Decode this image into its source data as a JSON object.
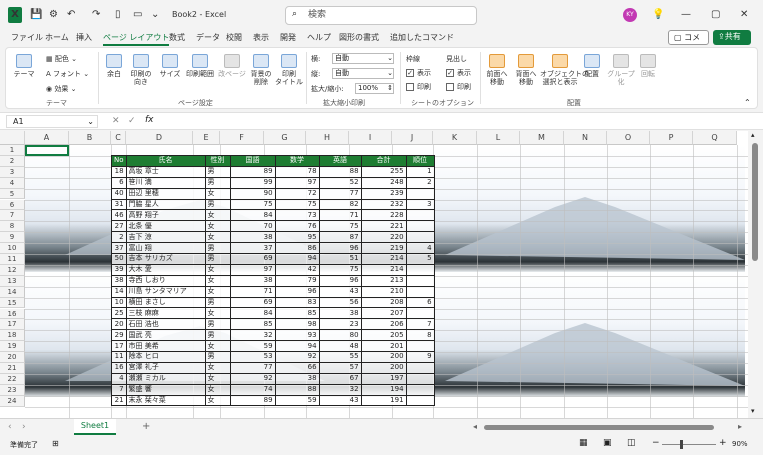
{
  "app": {
    "logo": "X",
    "doc_title": "Book2 - Excel",
    "search_placeholder": "検索",
    "avatar": "KY"
  },
  "tabs": [
    "ファイル",
    "ホーム",
    "挿入",
    "ページ レイアウト",
    "数式",
    "データ",
    "校閲",
    "表示",
    "開発",
    "ヘルプ",
    "図形の書式",
    "追加したコマンド"
  ],
  "comment_button": "コメント",
  "share_button": "共有",
  "ribbon": {
    "theme": {
      "theme": "テーマ",
      "colors": "配色",
      "fonts": "フォント",
      "effects": "効果",
      "group": "テーマ"
    },
    "page_setup": {
      "margins": "余白",
      "orientation": "印刷の\n向き",
      "size": "サイズ",
      "print_area": "印刷範囲",
      "breaks": "改ページ",
      "background": "背景の\n削除",
      "print_titles": "印刷\nタイトル",
      "group": "ページ設定"
    },
    "scale": {
      "width_label": "横:",
      "width_value": "自動",
      "height_label": "縦:",
      "height_value": "自動",
      "scale_label": "拡大/縮小:",
      "scale_value": "100%",
      "group": "拡大縮小印刷"
    },
    "sheet_options": {
      "gridlines": "枠線",
      "headings": "見出し",
      "view": "表示",
      "print": "印刷",
      "group": "シートのオプション"
    },
    "arrange": {
      "forward": "前面へ\n移動",
      "backward": "背面へ\n移動",
      "selection_pane": "オブジェクトの\n選択と表示",
      "align": "配置",
      "group_btn": "グループ化",
      "rotate": "回転",
      "group": "配置"
    }
  },
  "formula_bar": {
    "name_box": "A1",
    "fx": "fx",
    "value": ""
  },
  "columns": [
    "A",
    "B",
    "C",
    "D",
    "E",
    "F",
    "G",
    "H",
    "I",
    "J",
    "K",
    "L",
    "M",
    "N",
    "O",
    "P",
    "Q"
  ],
  "rows": [
    "1",
    "2",
    "3",
    "4",
    "5",
    "6",
    "7",
    "8",
    "9",
    "10",
    "11",
    "12",
    "13",
    "14",
    "15",
    "16",
    "17",
    "18",
    "19",
    "20",
    "21",
    "22",
    "23",
    "24"
  ],
  "table": {
    "headers": [
      "No",
      "氏名",
      "性別",
      "国語",
      "数学",
      "英語",
      "合計",
      "順位"
    ],
    "rows": [
      [
        "18",
        "高坂 章士",
        "男",
        "89",
        "78",
        "88",
        "255",
        "1"
      ],
      [
        "6",
        "笹川 満",
        "男",
        "99",
        "97",
        "52",
        "248",
        "2"
      ],
      [
        "40",
        "田辺 里穂",
        "女",
        "90",
        "72",
        "77",
        "239",
        ""
      ],
      [
        "31",
        "門脇 星人",
        "男",
        "75",
        "75",
        "82",
        "232",
        "3"
      ],
      [
        "46",
        "高野 翔子",
        "女",
        "84",
        "73",
        "71",
        "228",
        ""
      ],
      [
        "27",
        "北条 優",
        "女",
        "70",
        "76",
        "75",
        "221",
        ""
      ],
      [
        "2",
        "吉下 涼",
        "女",
        "38",
        "95",
        "87",
        "220",
        ""
      ],
      [
        "37",
        "富山 翔",
        "男",
        "37",
        "86",
        "96",
        "219",
        "4"
      ],
      [
        "50",
        "吉本 サリカズ",
        "男",
        "69",
        "94",
        "51",
        "214",
        "5"
      ],
      [
        "39",
        "大木 愛",
        "女",
        "97",
        "42",
        "75",
        "214",
        ""
      ],
      [
        "38",
        "寺西 しおり",
        "女",
        "38",
        "79",
        "96",
        "213",
        ""
      ],
      [
        "14",
        "川島 サンタマリア",
        "女",
        "71",
        "96",
        "43",
        "210",
        ""
      ],
      [
        "10",
        "横田 まさし",
        "男",
        "69",
        "83",
        "56",
        "208",
        "6"
      ],
      [
        "25",
        "三枝 麻麻",
        "女",
        "84",
        "85",
        "38",
        "207",
        ""
      ],
      [
        "20",
        "石田 浩也",
        "男",
        "85",
        "98",
        "23",
        "206",
        "7"
      ],
      [
        "29",
        "国武 亮",
        "男",
        "32",
        "93",
        "80",
        "205",
        "8"
      ],
      [
        "17",
        "市田 美希",
        "女",
        "59",
        "94",
        "48",
        "201",
        ""
      ],
      [
        "11",
        "除本 ヒロ",
        "男",
        "53",
        "92",
        "55",
        "200",
        "9"
      ],
      [
        "16",
        "宮澤 礼子",
        "女",
        "77",
        "66",
        "57",
        "200",
        ""
      ],
      [
        "4",
        "瀬瀬 ミカル",
        "女",
        "92",
        "38",
        "67",
        "197",
        ""
      ],
      [
        "7",
        "繁盛 響",
        "女",
        "74",
        "88",
        "32",
        "194",
        ""
      ],
      [
        "21",
        "末永 栞々菜",
        "女",
        "89",
        "59",
        "43",
        "191",
        ""
      ]
    ]
  },
  "sheet_tab": "Sheet1",
  "add_sheet": "+",
  "status": {
    "ready": "準備完了",
    "zoom": "90%"
  }
}
